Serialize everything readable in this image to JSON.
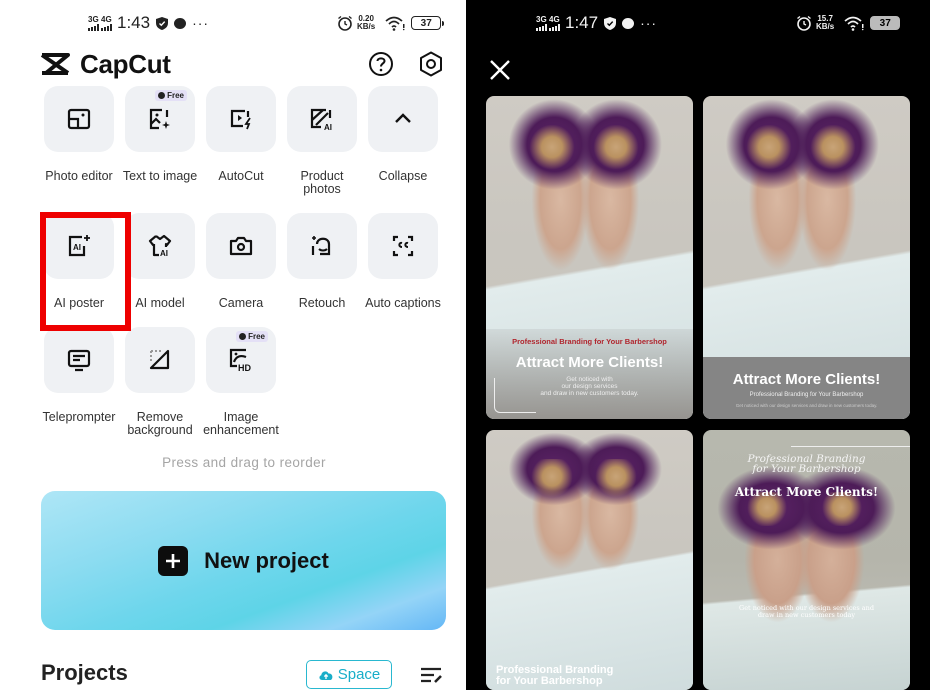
{
  "left_screen": {
    "status_bar": {
      "net1": "3G",
      "net2": "4G",
      "time": "1:43",
      "speed_value": "0.20",
      "speed_unit": "KB/s",
      "battery": "37",
      "more": "···"
    },
    "app": {
      "logo_text": "CapCut",
      "help_icon": "question-circle-icon",
      "settings_icon": "hexagon-gear-icon"
    },
    "tools": [
      {
        "label": "Photo editor",
        "icon": "photo-editor-icon",
        "badge": ""
      },
      {
        "label": "Text to image",
        "icon": "text-to-image-icon",
        "badge": "Free"
      },
      {
        "label": "AutoCut",
        "icon": "autocut-icon",
        "badge": ""
      },
      {
        "label": "Product\nphotos",
        "icon": "product-photos-icon",
        "badge": ""
      },
      {
        "label": "Collapse",
        "icon": "chevron-up-icon",
        "badge": ""
      },
      {
        "label": "AI poster",
        "icon": "ai-poster-icon",
        "badge": "",
        "highlighted": true
      },
      {
        "label": "AI model",
        "icon": "ai-model-icon",
        "badge": ""
      },
      {
        "label": "Camera",
        "icon": "camera-icon",
        "badge": ""
      },
      {
        "label": "Retouch",
        "icon": "retouch-icon",
        "badge": ""
      },
      {
        "label": "Auto captions",
        "icon": "auto-captions-icon",
        "badge": ""
      },
      {
        "label": "Teleprompter",
        "icon": "teleprompter-icon",
        "badge": ""
      },
      {
        "label": "Remove\nbackground",
        "icon": "remove-background-icon",
        "badge": ""
      },
      {
        "label": "Image\nenhancement",
        "icon": "image-enhancement-icon",
        "badge": "Free"
      }
    ],
    "hint": "Press and drag to reorder",
    "new_project_label": "New project",
    "projects_title": "Projects",
    "space_label": "Space",
    "highlight_color": "#ee0000"
  },
  "right_screen": {
    "status_bar": {
      "net1": "3G",
      "net2": "4G",
      "time": "1:47",
      "speed_value": "15.7",
      "speed_unit": "KB/s",
      "battery": "37",
      "more": "···"
    },
    "posters": [
      {
        "tagline": "Professional Branding for Your Barbershop",
        "headline": "Attract More Clients!",
        "body": "Get noticed with\nour design services\nand draw in new customers today."
      },
      {
        "headline": "Attract More Clients!",
        "tagline": "Professional Branding for Your Barbershop",
        "body": "Get noticed with our design services and draw in new customers today."
      },
      {
        "tagline": "Professional Branding\nfor Your Barbershop"
      },
      {
        "tagline": "Professional Branding\nfor Your Barbershop",
        "headline": "Attract More Clients!",
        "body": "Get noticed with our design services and\ndraw in new customers today"
      }
    ]
  }
}
